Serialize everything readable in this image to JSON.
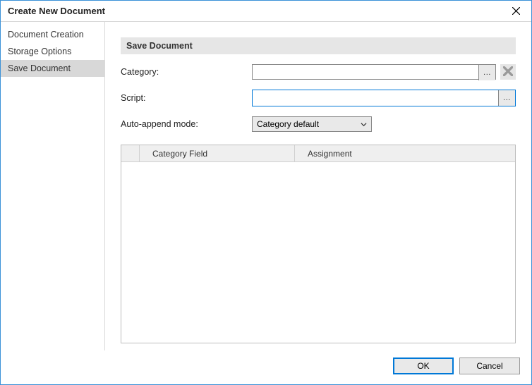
{
  "window": {
    "title": "Create New Document"
  },
  "sidebar": {
    "items": [
      {
        "label": "Document Creation",
        "selected": false
      },
      {
        "label": "Storage Options",
        "selected": false
      },
      {
        "label": "Save Document",
        "selected": true
      }
    ]
  },
  "panel": {
    "header": "Save Document",
    "fields": {
      "category": {
        "label": "Category:",
        "value": "",
        "browse": "..."
      },
      "script": {
        "label": "Script:",
        "value": "",
        "browse": "..."
      },
      "autoappend": {
        "label": "Auto-append mode:",
        "value": "Category default"
      }
    },
    "table": {
      "columns": [
        "Category Field",
        "Assignment"
      ],
      "rows": []
    }
  },
  "footer": {
    "ok": "OK",
    "cancel": "Cancel"
  }
}
